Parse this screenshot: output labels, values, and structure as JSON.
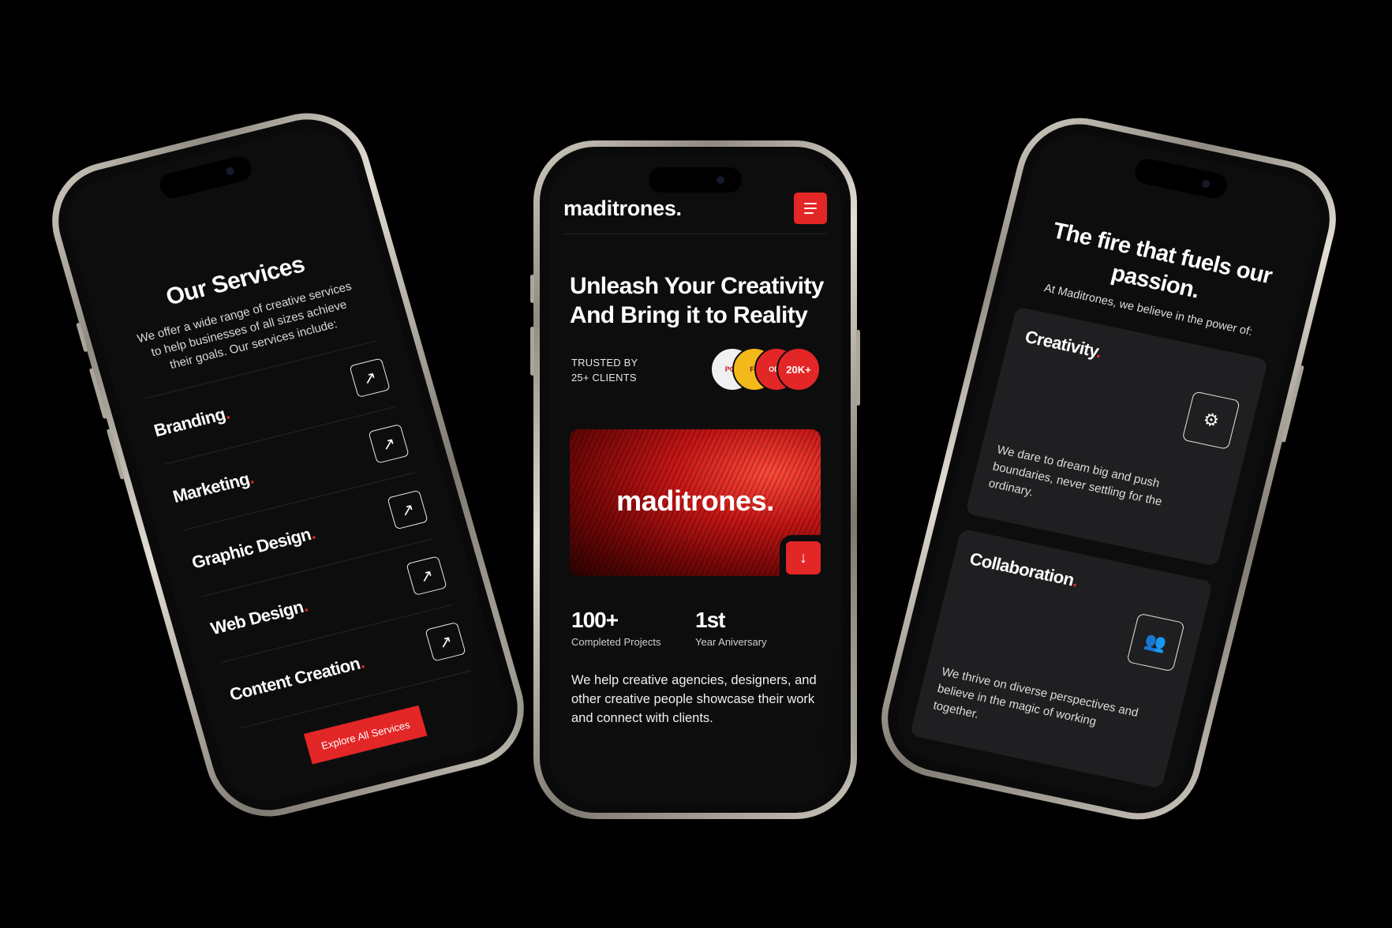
{
  "services_screen": {
    "title": "Our Services",
    "description": "We offer a wide range of creative services to help businesses of all sizes achieve their goals. Our services include:",
    "items": [
      {
        "label": "Branding"
      },
      {
        "label": "Marketing"
      },
      {
        "label": "Graphic Design"
      },
      {
        "label": "Web Design"
      },
      {
        "label": "Content Creation"
      }
    ],
    "dot": ".",
    "arrow_icon": "arrow-up-right-icon",
    "explore_button": "Explore All Services"
  },
  "home_screen": {
    "logo": "maditrones.",
    "menu_icon": "hamburger-menu-icon",
    "hero_title": "Unleash Your Creativity And Bring it to Reality",
    "trusted_line1": "TRUSTED BY",
    "trusted_line2": "25+ CLIENTS",
    "client_logos": [
      {
        "label": "POT"
      },
      {
        "label": "FY"
      },
      {
        "label": "ODY"
      },
      {
        "label": "20K+"
      }
    ],
    "banner_logo": "maditrones.",
    "down_icon": "arrow-down-icon",
    "stats": [
      {
        "value": "100+",
        "label": "Completed Projects"
      },
      {
        "value": "1st",
        "label": "Year Aniversary"
      }
    ],
    "about": "We help creative agencies, designers, and other creative people showcase their work and connect with clients."
  },
  "passion_screen": {
    "title": "The fire that fuels our passion.",
    "subtitle": "At Maditrones, we believe in the power of:",
    "cards": [
      {
        "title": "Creativity",
        "icon": "lightbulb-gear-icon",
        "text": "We dare to dream big and push boundaries, never settling for the ordinary."
      },
      {
        "title": "Collaboration",
        "icon": "team-icon",
        "text": "We thrive on diverse perspectives and believe in the magic of working together."
      }
    ]
  },
  "colors": {
    "accent": "#e32626",
    "background": "#000000",
    "screen": "#0d0d0e",
    "card": "#1f1f21"
  }
}
